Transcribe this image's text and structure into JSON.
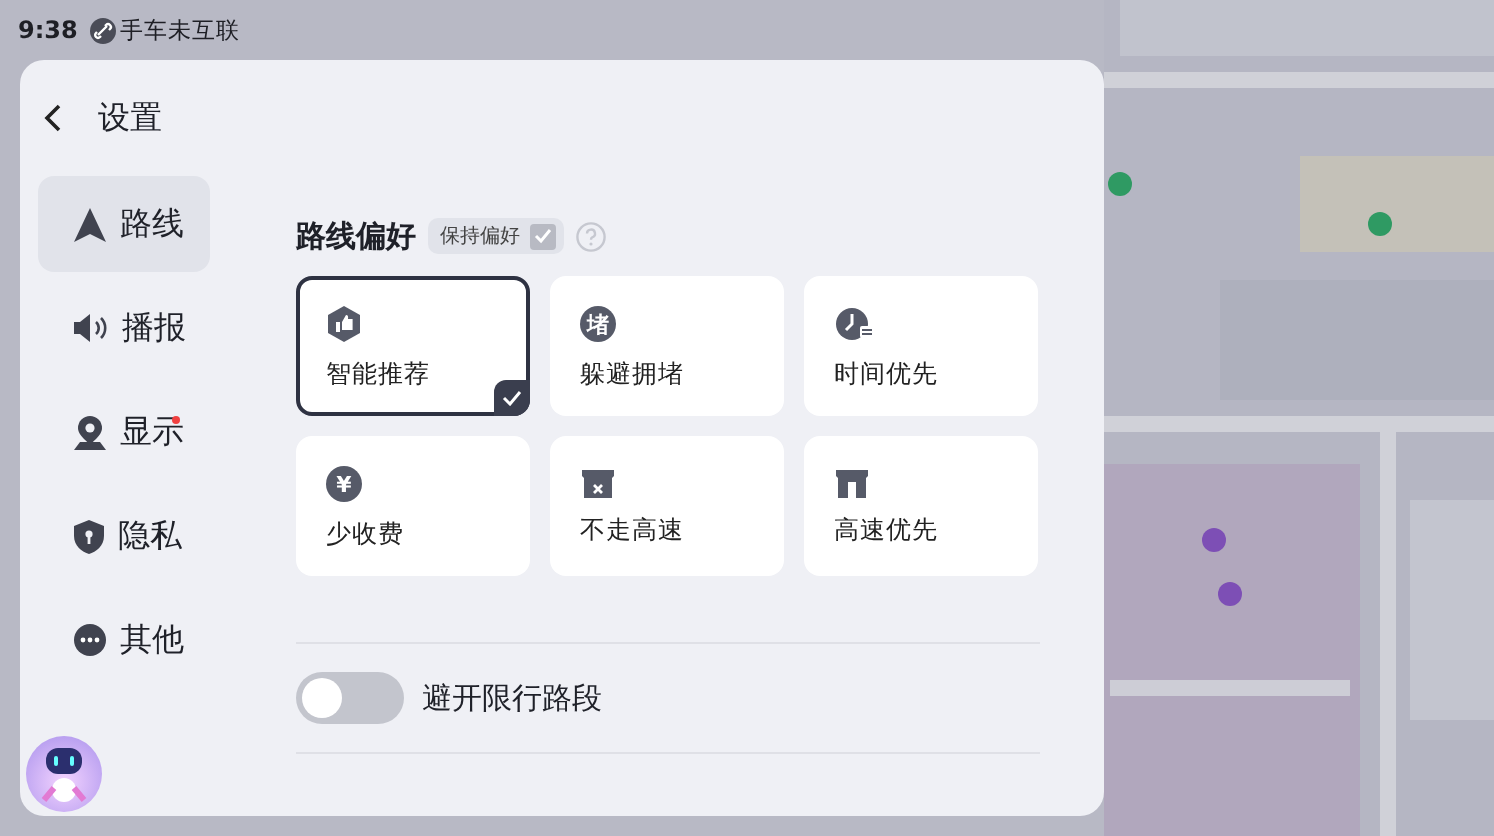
{
  "status_bar": {
    "time": "9:38",
    "connection": "手车未互联"
  },
  "header": {
    "title": "设置"
  },
  "sidebar": {
    "items": [
      {
        "label": "路线",
        "kind": "route",
        "selected": true,
        "dot": false
      },
      {
        "label": "播报",
        "kind": "voice",
        "selected": false,
        "dot": false
      },
      {
        "label": "显示",
        "kind": "display",
        "selected": false,
        "dot": true
      },
      {
        "label": "隐私",
        "kind": "privacy",
        "selected": false,
        "dot": false
      },
      {
        "label": "其他",
        "kind": "other",
        "selected": false,
        "dot": false
      }
    ]
  },
  "route_preference": {
    "title": "路线偏好",
    "keep_label": "保持偏好",
    "keep_checked": true,
    "options": [
      {
        "label": "智能推荐",
        "kind": "recommend",
        "selected": true
      },
      {
        "label": "躲避拥堵",
        "kind": "congestion",
        "icon_text": "堵",
        "selected": false
      },
      {
        "label": "时间优先",
        "kind": "time",
        "selected": false
      },
      {
        "label": "少收费",
        "kind": "toll",
        "icon_text": "¥",
        "selected": false
      },
      {
        "label": "不走高速",
        "kind": "no-highway",
        "selected": false
      },
      {
        "label": "高速优先",
        "kind": "highway",
        "selected": false
      }
    ]
  },
  "restriction_toggle": {
    "label": "避开限行路段",
    "on": false
  }
}
